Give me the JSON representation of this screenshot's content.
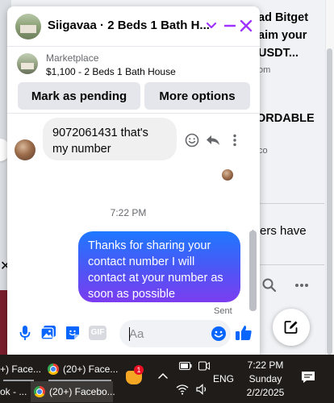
{
  "background": {
    "ad_lines": [
      "ad Bitget",
      "aim your",
      "USDT...",
      "om"
    ],
    "affordable": "ORDABLE",
    "affordable_sub": "co",
    "members_text": "ers have"
  },
  "chat": {
    "title": "Siigavaa · 2 Beds 1 Bath H...",
    "marketplace_label": "Marketplace",
    "listing": "$1,100 - 2 Beds 1 Bath House",
    "actions": {
      "mark_pending": "Mark as pending",
      "more_options": "More options"
    },
    "messages": {
      "received": "9072061431 that's my number",
      "timestamp": "7:22 PM",
      "sent": "Thanks for sharing your contact number I will contact at your number as soon as possible",
      "sent_status": "Sent"
    },
    "composer": {
      "placeholder": "Aa",
      "gif_label": "GIF"
    }
  },
  "taskbar": {
    "items": [
      {
        "label": "+) Face..."
      },
      {
        "label": "(20+) Face..."
      },
      {
        "label": "ok - ..."
      },
      {
        "label": "(20+) Facebo..."
      }
    ],
    "notification_count": "1",
    "language": "ENG",
    "time": "7:22 PM",
    "day": "Sunday",
    "date": "2/2/2025"
  },
  "colors": {
    "messenger_accent": "#a033ff",
    "facebook_blue": "#0866ff",
    "sent_bubble_top": "#1e78ff",
    "sent_bubble_bottom": "#7b3df0"
  }
}
